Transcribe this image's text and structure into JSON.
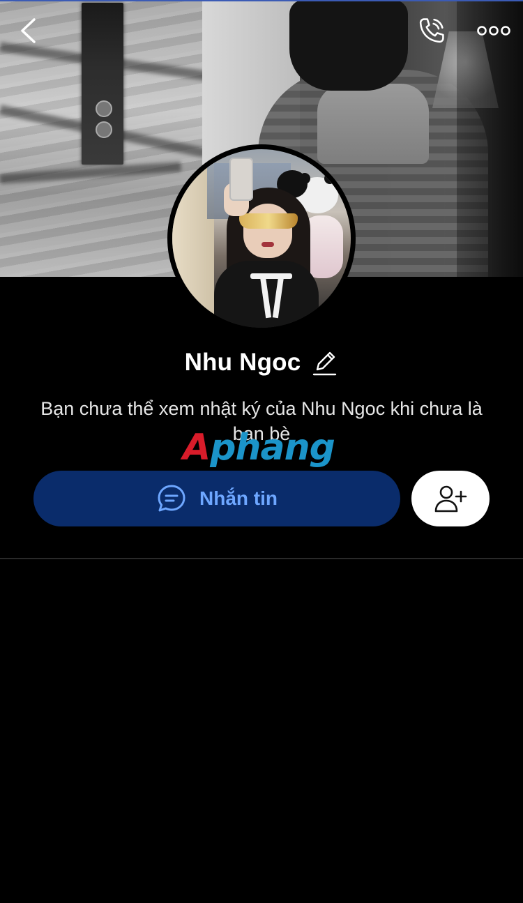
{
  "profile": {
    "name": "Nhu Ngoc",
    "notice": "Bạn chưa thể xem nhật ký của Nhu Ngoc khi chưa là bạn bè"
  },
  "actions": {
    "message_label": "Nhắn tin"
  },
  "watermark": {
    "part1": "A",
    "part2": "phang"
  },
  "icons": {
    "back": "chevron-left-icon",
    "call": "phone-icon",
    "more": "more-dots-icon",
    "edit": "pencil-icon",
    "message": "chat-bubble-icon",
    "add_friend": "add-user-icon"
  },
  "colors": {
    "background": "#000000",
    "message_button_bg": "#0a2c6b",
    "message_button_text": "#6ea7ff",
    "add_button_bg": "#ffffff",
    "name_text": "#ffffff"
  }
}
